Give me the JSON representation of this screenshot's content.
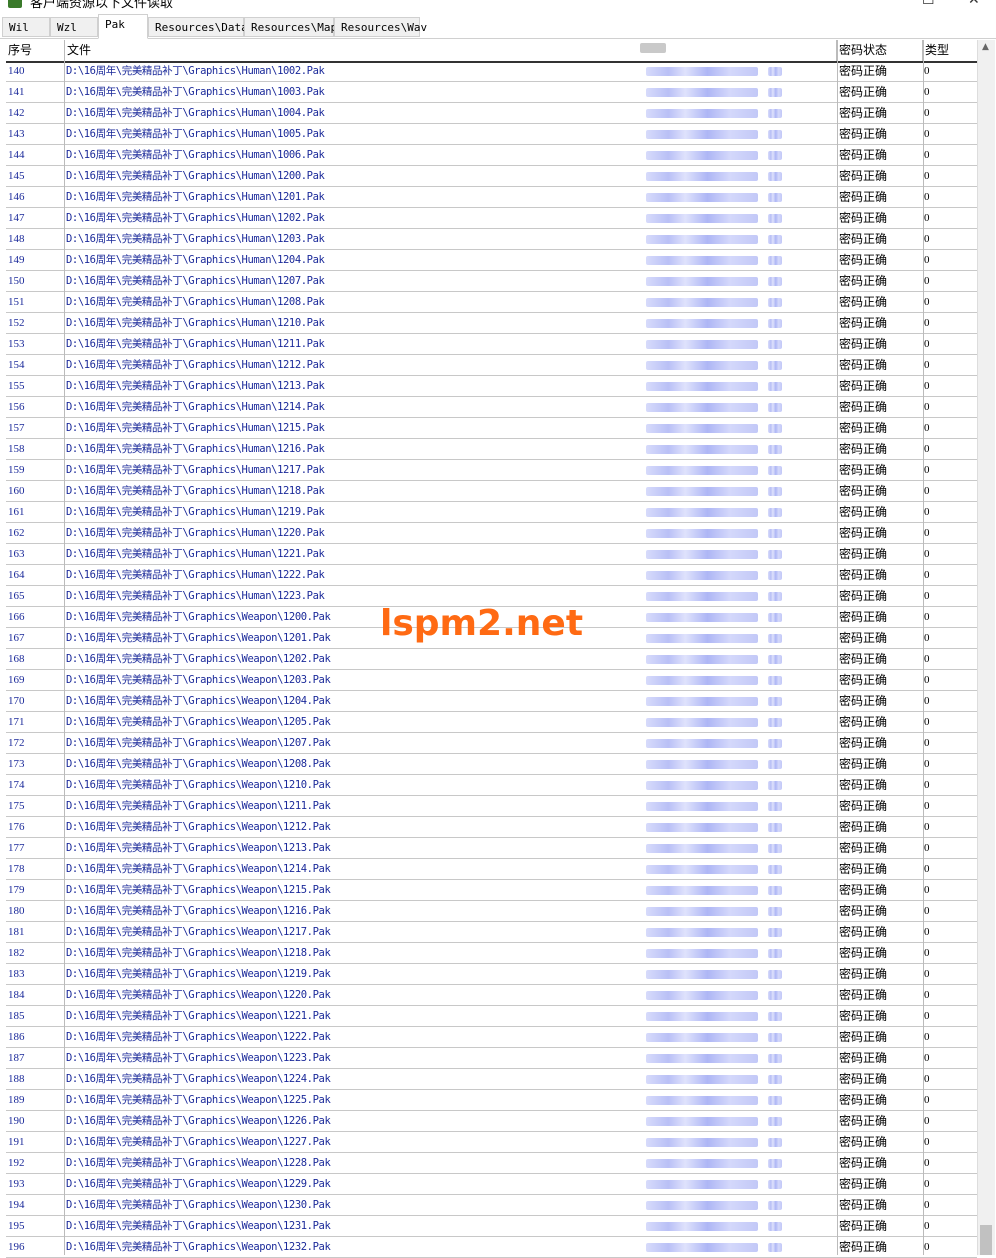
{
  "window": {
    "title": "客户端资源以下文件读取",
    "close_glyph": "✕",
    "max_glyph": "☐"
  },
  "tabs": [
    {
      "label": "Wil",
      "active": false
    },
    {
      "label": "Wzl",
      "active": false
    },
    {
      "label": "Pak",
      "active": true
    },
    {
      "label": "Resources\\Data",
      "active": false
    },
    {
      "label": "Resources\\Map",
      "active": false
    },
    {
      "label": "Resources\\Wav",
      "active": false
    }
  ],
  "grid": {
    "columns": {
      "index": "序号",
      "file": "文件",
      "password": "",
      "status": "密码状态",
      "type": "类型"
    },
    "rows": [
      {
        "index": "140",
        "file": "D:\\16周年\\完美精品补丁\\Graphics\\Human\\1002.Pak",
        "status": "密码正确",
        "type": "0"
      },
      {
        "index": "141",
        "file": "D:\\16周年\\完美精品补丁\\Graphics\\Human\\1003.Pak",
        "status": "密码正确",
        "type": "0"
      },
      {
        "index": "142",
        "file": "D:\\16周年\\完美精品补丁\\Graphics\\Human\\1004.Pak",
        "status": "密码正确",
        "type": "0"
      },
      {
        "index": "143",
        "file": "D:\\16周年\\完美精品补丁\\Graphics\\Human\\1005.Pak",
        "status": "密码正确",
        "type": "0"
      },
      {
        "index": "144",
        "file": "D:\\16周年\\完美精品补丁\\Graphics\\Human\\1006.Pak",
        "status": "密码正确",
        "type": "0"
      },
      {
        "index": "145",
        "file": "D:\\16周年\\完美精品补丁\\Graphics\\Human\\1200.Pak",
        "status": "密码正确",
        "type": "0"
      },
      {
        "index": "146",
        "file": "D:\\16周年\\完美精品补丁\\Graphics\\Human\\1201.Pak",
        "status": "密码正确",
        "type": "0"
      },
      {
        "index": "147",
        "file": "D:\\16周年\\完美精品补丁\\Graphics\\Human\\1202.Pak",
        "status": "密码正确",
        "type": "0"
      },
      {
        "index": "148",
        "file": "D:\\16周年\\完美精品补丁\\Graphics\\Human\\1203.Pak",
        "status": "密码正确",
        "type": "0"
      },
      {
        "index": "149",
        "file": "D:\\16周年\\完美精品补丁\\Graphics\\Human\\1204.Pak",
        "status": "密码正确",
        "type": "0"
      },
      {
        "index": "150",
        "file": "D:\\16周年\\完美精品补丁\\Graphics\\Human\\1207.Pak",
        "status": "密码正确",
        "type": "0"
      },
      {
        "index": "151",
        "file": "D:\\16周年\\完美精品补丁\\Graphics\\Human\\1208.Pak",
        "status": "密码正确",
        "type": "0"
      },
      {
        "index": "152",
        "file": "D:\\16周年\\完美精品补丁\\Graphics\\Human\\1210.Pak",
        "status": "密码正确",
        "type": "0"
      },
      {
        "index": "153",
        "file": "D:\\16周年\\完美精品补丁\\Graphics\\Human\\1211.Pak",
        "status": "密码正确",
        "type": "0"
      },
      {
        "index": "154",
        "file": "D:\\16周年\\完美精品补丁\\Graphics\\Human\\1212.Pak",
        "status": "密码正确",
        "type": "0"
      },
      {
        "index": "155",
        "file": "D:\\16周年\\完美精品补丁\\Graphics\\Human\\1213.Pak",
        "status": "密码正确",
        "type": "0"
      },
      {
        "index": "156",
        "file": "D:\\16周年\\完美精品补丁\\Graphics\\Human\\1214.Pak",
        "status": "密码正确",
        "type": "0"
      },
      {
        "index": "157",
        "file": "D:\\16周年\\完美精品补丁\\Graphics\\Human\\1215.Pak",
        "status": "密码正确",
        "type": "0"
      },
      {
        "index": "158",
        "file": "D:\\16周年\\完美精品补丁\\Graphics\\Human\\1216.Pak",
        "status": "密码正确",
        "type": "0"
      },
      {
        "index": "159",
        "file": "D:\\16周年\\完美精品补丁\\Graphics\\Human\\1217.Pak",
        "status": "密码正确",
        "type": "0"
      },
      {
        "index": "160",
        "file": "D:\\16周年\\完美精品补丁\\Graphics\\Human\\1218.Pak",
        "status": "密码正确",
        "type": "0"
      },
      {
        "index": "161",
        "file": "D:\\16周年\\完美精品补丁\\Graphics\\Human\\1219.Pak",
        "status": "密码正确",
        "type": "0"
      },
      {
        "index": "162",
        "file": "D:\\16周年\\完美精品补丁\\Graphics\\Human\\1220.Pak",
        "status": "密码正确",
        "type": "0"
      },
      {
        "index": "163",
        "file": "D:\\16周年\\完美精品补丁\\Graphics\\Human\\1221.Pak",
        "status": "密码正确",
        "type": "0"
      },
      {
        "index": "164",
        "file": "D:\\16周年\\完美精品补丁\\Graphics\\Human\\1222.Pak",
        "status": "密码正确",
        "type": "0"
      },
      {
        "index": "165",
        "file": "D:\\16周年\\完美精品补丁\\Graphics\\Human\\1223.Pak",
        "status": "密码正确",
        "type": "0"
      },
      {
        "index": "166",
        "file": "D:\\16周年\\完美精品补丁\\Graphics\\Weapon\\1200.Pak",
        "status": "密码正确",
        "type": "0"
      },
      {
        "index": "167",
        "file": "D:\\16周年\\完美精品补丁\\Graphics\\Weapon\\1201.Pak",
        "status": "密码正确",
        "type": "0"
      },
      {
        "index": "168",
        "file": "D:\\16周年\\完美精品补丁\\Graphics\\Weapon\\1202.Pak",
        "status": "密码正确",
        "type": "0"
      },
      {
        "index": "169",
        "file": "D:\\16周年\\完美精品补丁\\Graphics\\Weapon\\1203.Pak",
        "status": "密码正确",
        "type": "0"
      },
      {
        "index": "170",
        "file": "D:\\16周年\\完美精品补丁\\Graphics\\Weapon\\1204.Pak",
        "status": "密码正确",
        "type": "0"
      },
      {
        "index": "171",
        "file": "D:\\16周年\\完美精品补丁\\Graphics\\Weapon\\1205.Pak",
        "status": "密码正确",
        "type": "0"
      },
      {
        "index": "172",
        "file": "D:\\16周年\\完美精品补丁\\Graphics\\Weapon\\1207.Pak",
        "status": "密码正确",
        "type": "0"
      },
      {
        "index": "173",
        "file": "D:\\16周年\\完美精品补丁\\Graphics\\Weapon\\1208.Pak",
        "status": "密码正确",
        "type": "0"
      },
      {
        "index": "174",
        "file": "D:\\16周年\\完美精品补丁\\Graphics\\Weapon\\1210.Pak",
        "status": "密码正确",
        "type": "0"
      },
      {
        "index": "175",
        "file": "D:\\16周年\\完美精品补丁\\Graphics\\Weapon\\1211.Pak",
        "status": "密码正确",
        "type": "0"
      },
      {
        "index": "176",
        "file": "D:\\16周年\\完美精品补丁\\Graphics\\Weapon\\1212.Pak",
        "status": "密码正确",
        "type": "0"
      },
      {
        "index": "177",
        "file": "D:\\16周年\\完美精品补丁\\Graphics\\Weapon\\1213.Pak",
        "status": "密码正确",
        "type": "0"
      },
      {
        "index": "178",
        "file": "D:\\16周年\\完美精品补丁\\Graphics\\Weapon\\1214.Pak",
        "status": "密码正确",
        "type": "0"
      },
      {
        "index": "179",
        "file": "D:\\16周年\\完美精品补丁\\Graphics\\Weapon\\1215.Pak",
        "status": "密码正确",
        "type": "0"
      },
      {
        "index": "180",
        "file": "D:\\16周年\\完美精品补丁\\Graphics\\Weapon\\1216.Pak",
        "status": "密码正确",
        "type": "0"
      },
      {
        "index": "181",
        "file": "D:\\16周年\\完美精品补丁\\Graphics\\Weapon\\1217.Pak",
        "status": "密码正确",
        "type": "0"
      },
      {
        "index": "182",
        "file": "D:\\16周年\\完美精品补丁\\Graphics\\Weapon\\1218.Pak",
        "status": "密码正确",
        "type": "0"
      },
      {
        "index": "183",
        "file": "D:\\16周年\\完美精品补丁\\Graphics\\Weapon\\1219.Pak",
        "status": "密码正确",
        "type": "0"
      },
      {
        "index": "184",
        "file": "D:\\16周年\\完美精品补丁\\Graphics\\Weapon\\1220.Pak",
        "status": "密码正确",
        "type": "0"
      },
      {
        "index": "185",
        "file": "D:\\16周年\\完美精品补丁\\Graphics\\Weapon\\1221.Pak",
        "status": "密码正确",
        "type": "0"
      },
      {
        "index": "186",
        "file": "D:\\16周年\\完美精品补丁\\Graphics\\Weapon\\1222.Pak",
        "status": "密码正确",
        "type": "0"
      },
      {
        "index": "187",
        "file": "D:\\16周年\\完美精品补丁\\Graphics\\Weapon\\1223.Pak",
        "status": "密码正确",
        "type": "0"
      },
      {
        "index": "188",
        "file": "D:\\16周年\\完美精品补丁\\Graphics\\Weapon\\1224.Pak",
        "status": "密码正确",
        "type": "0"
      },
      {
        "index": "189",
        "file": "D:\\16周年\\完美精品补丁\\Graphics\\Weapon\\1225.Pak",
        "status": "密码正确",
        "type": "0"
      },
      {
        "index": "190",
        "file": "D:\\16周年\\完美精品补丁\\Graphics\\Weapon\\1226.Pak",
        "status": "密码正确",
        "type": "0"
      },
      {
        "index": "191",
        "file": "D:\\16周年\\完美精品补丁\\Graphics\\Weapon\\1227.Pak",
        "status": "密码正确",
        "type": "0"
      },
      {
        "index": "192",
        "file": "D:\\16周年\\完美精品补丁\\Graphics\\Weapon\\1228.Pak",
        "status": "密码正确",
        "type": "0"
      },
      {
        "index": "193",
        "file": "D:\\16周年\\完美精品补丁\\Graphics\\Weapon\\1229.Pak",
        "status": "密码正确",
        "type": "0"
      },
      {
        "index": "194",
        "file": "D:\\16周年\\完美精品补丁\\Graphics\\Weapon\\1230.Pak",
        "status": "密码正确",
        "type": "0"
      },
      {
        "index": "195",
        "file": "D:\\16周年\\完美精品补丁\\Graphics\\Weapon\\1231.Pak",
        "status": "密码正确",
        "type": "0"
      },
      {
        "index": "196",
        "file": "D:\\16周年\\完美精品补丁\\Graphics\\Weapon\\1232.Pak",
        "status": "密码正确",
        "type": "0"
      }
    ]
  },
  "watermark": {
    "text": "lspm2.net",
    "color": "#ff6a13"
  },
  "colors": {
    "text_link": "#1b2a9a",
    "blur": "#b9c0f6"
  }
}
